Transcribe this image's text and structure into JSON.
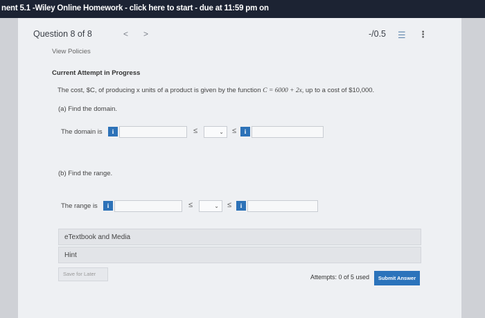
{
  "header": {
    "title": "nent 5.1 -Wiley Online Homework - click here to start - due at 11:59 pm on"
  },
  "question": {
    "label": "Question 8 of 8",
    "prev_glyph": "<",
    "next_glyph": ">",
    "score": "-/0.5",
    "list_icon": "list-icon",
    "more_icon": "more-vertical-icon"
  },
  "policies_link": "View Policies",
  "attempt_status": "Current Attempt in Progress",
  "problem": {
    "text_before": "The cost, $C, of producing  x units of a product is given by the function ",
    "formula": "C = 6000 + 2x,",
    "text_after": " up to a cost of $10,000."
  },
  "part_a": {
    "prompt": "(a) Find the domain.",
    "row_label": "The domain is",
    "leq": "≤",
    "info_glyph": "i",
    "select_glyph": "⌄"
  },
  "part_b": {
    "prompt": "(b) Find the range.",
    "row_label": "The range is",
    "leq": "≤",
    "info_glyph": "i",
    "select_glyph": "⌄"
  },
  "etextbook": "eTextbook and Media",
  "hint": "Hint",
  "save_later": "Save for Later",
  "attempts": "Attempts: 0 of 5 used",
  "submit": "Submit Answer",
  "colors": {
    "topbar": "#1c2333",
    "accent": "#2b73bb",
    "panel": "#eef0f3"
  }
}
